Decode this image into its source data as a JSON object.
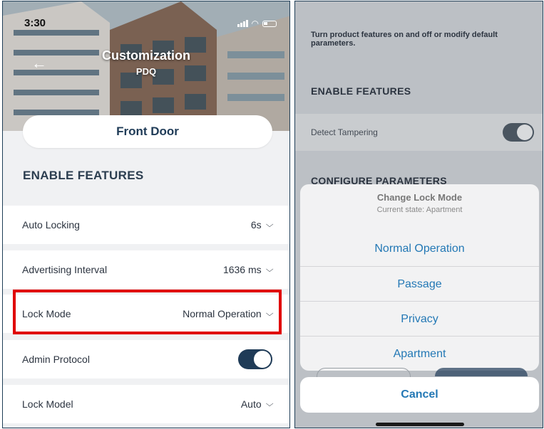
{
  "left": {
    "status": {
      "time": "3:30"
    },
    "header": {
      "title": "Customization",
      "subtitle": "PDQ"
    },
    "door_name": "Front Door",
    "section_title": "ENABLE FEATURES",
    "rows": [
      {
        "label": "Auto Locking",
        "value": "6s"
      },
      {
        "label": "Advertising Interval",
        "value": "1636 ms"
      },
      {
        "label": "Lock Mode",
        "value": "Normal Operation"
      },
      {
        "label": "Admin Protocol",
        "toggle": "on"
      },
      {
        "label": "Lock Model",
        "value": "Auto"
      }
    ]
  },
  "right": {
    "description": "Turn product features on and off or modify default parameters.",
    "section_title": "ENABLE FEATURES",
    "feature_row": {
      "label": "Detect Tampering",
      "toggle": "on"
    },
    "section2_title": "CONFIGURE PARAMETERS",
    "sheet": {
      "title": "Change Lock Mode",
      "subtitle": "Current state: Apartment",
      "options": [
        "Normal Operation",
        "Passage",
        "Privacy",
        "Apartment"
      ],
      "cancel": "Cancel"
    }
  },
  "colors": {
    "accent": "#1f3b57",
    "link": "#2378b5",
    "highlight": "#e00000"
  }
}
